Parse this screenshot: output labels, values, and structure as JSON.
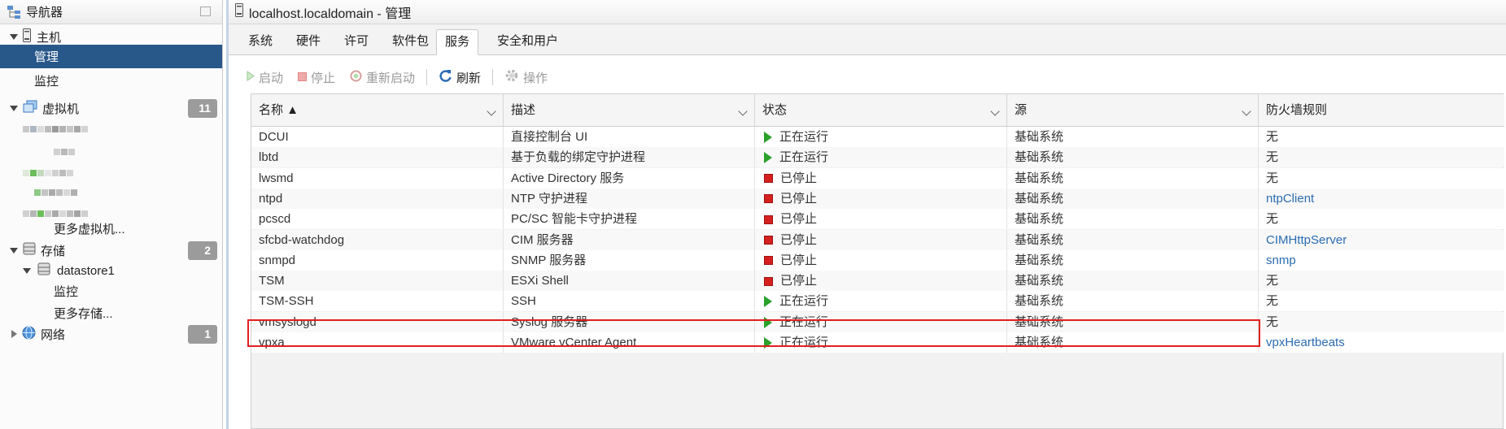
{
  "navigator": {
    "title": "导航器",
    "host": {
      "label": "主机",
      "children": [
        "管理",
        "监控"
      ],
      "selected": "管理"
    },
    "vms": {
      "label": "虚拟机",
      "count": "11",
      "more": "更多虚拟机..."
    },
    "storage": {
      "label": "存储",
      "count": "2",
      "datastore": "datastore1",
      "children": [
        "监控",
        "更多存储..."
      ]
    },
    "network": {
      "label": "网络",
      "count": "1"
    }
  },
  "main": {
    "title": "localhost.localdomain - 管理",
    "tabs": [
      "系统",
      "硬件",
      "许可",
      "软件包",
      "服务",
      "安全和用户"
    ],
    "active_tab": "服务",
    "toolbar": {
      "start": "启动",
      "stop": "停止",
      "restart": "重新启动",
      "refresh": "刷新",
      "actions": "操作"
    },
    "columns": [
      "名称 ▲",
      "描述",
      "状态",
      "源",
      "防火墙规则"
    ],
    "rows": [
      {
        "name": "DCUI",
        "desc": "直接控制台 UI",
        "status": "正在运行",
        "running": true,
        "source": "基础系统",
        "fw": "无"
      },
      {
        "name": "lbtd",
        "desc": "基于负载的绑定守护进程",
        "status": "正在运行",
        "running": true,
        "source": "基础系统",
        "fw": "无"
      },
      {
        "name": "lwsmd",
        "desc": "Active Directory 服务",
        "status": "已停止",
        "running": false,
        "source": "基础系统",
        "fw": "无"
      },
      {
        "name": "ntpd",
        "desc": "NTP 守护进程",
        "status": "已停止",
        "running": false,
        "source": "基础系统",
        "fw": "ntpClient"
      },
      {
        "name": "pcscd",
        "desc": "PC/SC 智能卡守护进程",
        "status": "已停止",
        "running": false,
        "source": "基础系统",
        "fw": "无"
      },
      {
        "name": "sfcbd-watchdog",
        "desc": "CIM 服务器",
        "status": "已停止",
        "running": false,
        "source": "基础系统",
        "fw": "CIMHttpServer"
      },
      {
        "name": "snmpd",
        "desc": "SNMP 服务器",
        "status": "已停止",
        "running": false,
        "source": "基础系统",
        "fw": "snmp"
      },
      {
        "name": "TSM",
        "desc": "ESXi Shell",
        "status": "已停止",
        "running": false,
        "source": "基础系统",
        "fw": "无"
      },
      {
        "name": "TSM-SSH",
        "desc": "SSH",
        "status": "正在运行",
        "running": true,
        "source": "基础系统",
        "fw": "无"
      },
      {
        "name": "vmsyslogd",
        "desc": "Syslog 服务器",
        "status": "正在运行",
        "running": true,
        "source": "基础系统",
        "fw": "无"
      },
      {
        "name": "vpxa",
        "desc": "VMware vCenter Agent",
        "status": "正在运行",
        "running": true,
        "source": "基础系统",
        "fw": "vpxHeartbeats"
      }
    ]
  },
  "colors": {
    "selected": "#28578a",
    "running": "#2aa12a",
    "stopped": "#d62020",
    "link": "#2b6cb0",
    "highlight": "#e0201f"
  }
}
